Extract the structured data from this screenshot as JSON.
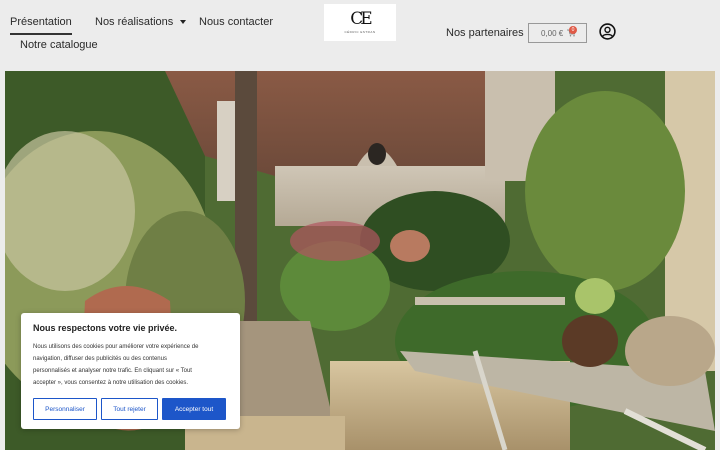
{
  "nav": {
    "items": [
      {
        "label": "Présentation"
      },
      {
        "label": "Nos réalisations"
      },
      {
        "label": "Nous contacter"
      },
      {
        "label": "Notre catalogue"
      }
    ],
    "partners_label": "Nos partenaires"
  },
  "logo": {
    "mark": "CE",
    "text": "CÉDRIC ESTRAN"
  },
  "cart": {
    "amount": "0,00 €",
    "count": "0",
    "icon": "cart-icon"
  },
  "account": {
    "icon": "user-circle-icon"
  },
  "cookie": {
    "title": "Nous respectons votre vie privée.",
    "lines": [
      "Nous utilisons des cookies pour améliorer votre expérience de",
      "navigation, diffuser des publicités ou des contenus",
      "personnalisés et analyser notre trafic. En cliquant sur « Tout",
      "accepter », vous consentez à notre utilisation des cookies."
    ],
    "customize_label": "Personnaliser",
    "reject_label": "Tout rejeter",
    "accept_label": "Accepter tout"
  },
  "colors": {
    "accent": "#1d56c9",
    "badge": "#e05a47",
    "header_bg": "#ececec"
  }
}
